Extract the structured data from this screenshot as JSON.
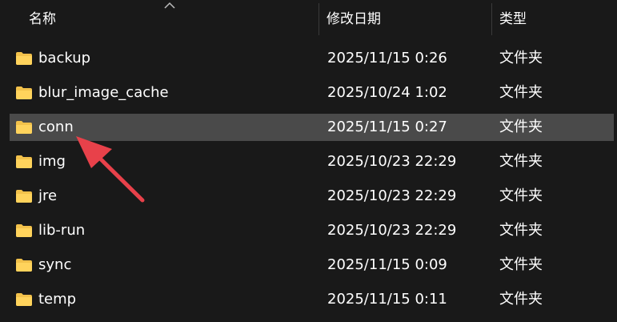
{
  "header": {
    "columns": [
      {
        "label": "名称"
      },
      {
        "label": "修改日期"
      },
      {
        "label": "类型"
      }
    ]
  },
  "files": [
    {
      "name": "backup",
      "modified": "2025/11/15 0:26",
      "type": "文件夹"
    },
    {
      "name": "blur_image_cache",
      "modified": "2025/10/24 1:02",
      "type": "文件夹"
    },
    {
      "name": "conn",
      "modified": "2025/11/15 0:27",
      "type": "文件夹",
      "selected": true
    },
    {
      "name": "img",
      "modified": "2025/10/23 22:29",
      "type": "文件夹"
    },
    {
      "name": "jre",
      "modified": "2025/10/23 22:29",
      "type": "文件夹"
    },
    {
      "name": "lib-run",
      "modified": "2025/10/23 22:29",
      "type": "文件夹"
    },
    {
      "name": "sync",
      "modified": "2025/11/15 0:09",
      "type": "文件夹"
    },
    {
      "name": "temp",
      "modified": "2025/11/15 0:11",
      "type": "文件夹"
    }
  ],
  "icons": {
    "folder": "folder-icon",
    "sort": "sort-ascending-icon"
  },
  "colors": {
    "background": "#191919",
    "selected_row": "#4a4a4a",
    "folder": "#f2c14b",
    "annotation_arrow": "#e8414a"
  }
}
